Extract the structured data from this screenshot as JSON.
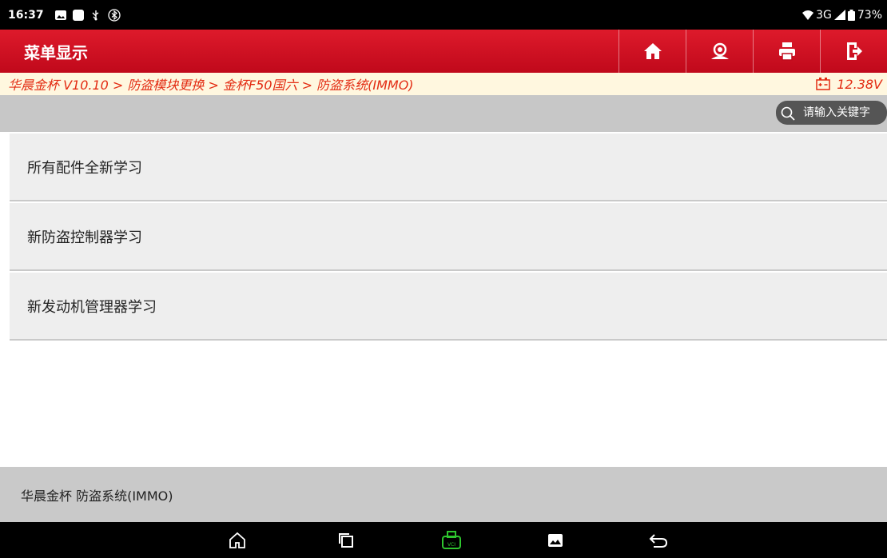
{
  "status_bar": {
    "time": "16:37",
    "network": "3G",
    "battery": "73%",
    "icons": [
      "gallery-icon",
      "square-notification-icon",
      "usb-icon",
      "bluetooth-icon",
      "wifi-icon",
      "signal-icon",
      "battery-icon"
    ]
  },
  "header": {
    "title": "菜单显示",
    "buttons": [
      "home-icon",
      "support-icon",
      "print-icon",
      "exit-icon"
    ]
  },
  "breadcrumb": {
    "path": "华晨金杯 V10.10 > 防盗模块更换 > 金杯F50国六 > 防盗系统(IMMO)",
    "voltage": "12.38V"
  },
  "search": {
    "placeholder": "请输入关键字"
  },
  "menu": {
    "items": [
      {
        "label": "所有配件全新学习"
      },
      {
        "label": "新防盗控制器学习"
      },
      {
        "label": "新发动机管理器学习"
      }
    ]
  },
  "footer": {
    "text": "华晨金杯 防盗系统(IMMO)"
  },
  "nav_bar": {
    "buttons": [
      "home-icon",
      "recent-apps-icon",
      "vci-icon",
      "screenshot-icon",
      "back-icon"
    ],
    "vci_label": "VCI"
  },
  "colors": {
    "header_red": "#d01224",
    "breadcrumb_text": "#e32b12",
    "breadcrumb_bg": "#fff7df",
    "vci_green": "#2ec52e"
  }
}
